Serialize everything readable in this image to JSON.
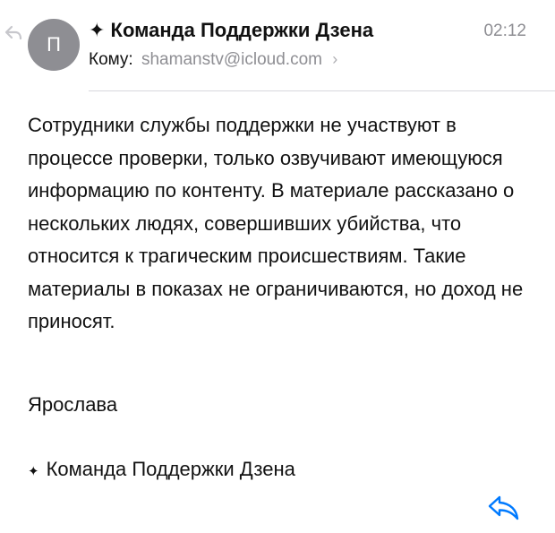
{
  "header": {
    "avatar_initial": "П",
    "sender": "✦ Команда Поддержки Дзена",
    "time": "02:12",
    "to_label": "Кому:",
    "to_address": "shamanstv@icloud.com",
    "chevron": "›"
  },
  "message": {
    "body": "Сотрудники службы поддержки не участвуют в процессе проверки, только озвучивают имеющуюся информацию по контенту. В материале рассказано о нескольких людях, совершивших убийства, что относится к трагическим происшествиям. Такие материалы в показах не ограничиваются, но доход не приносят.",
    "signature_name": "Ярослава",
    "signature_star": "✦",
    "signature_team": "Команда Поддержки Дзена"
  },
  "icons": {
    "replied": "reply-arrow-icon",
    "reply": "reply-icon"
  },
  "colors": {
    "accent": "#007aff",
    "avatar_bg": "#8e8e93",
    "secondary_text": "#8e8e93"
  }
}
